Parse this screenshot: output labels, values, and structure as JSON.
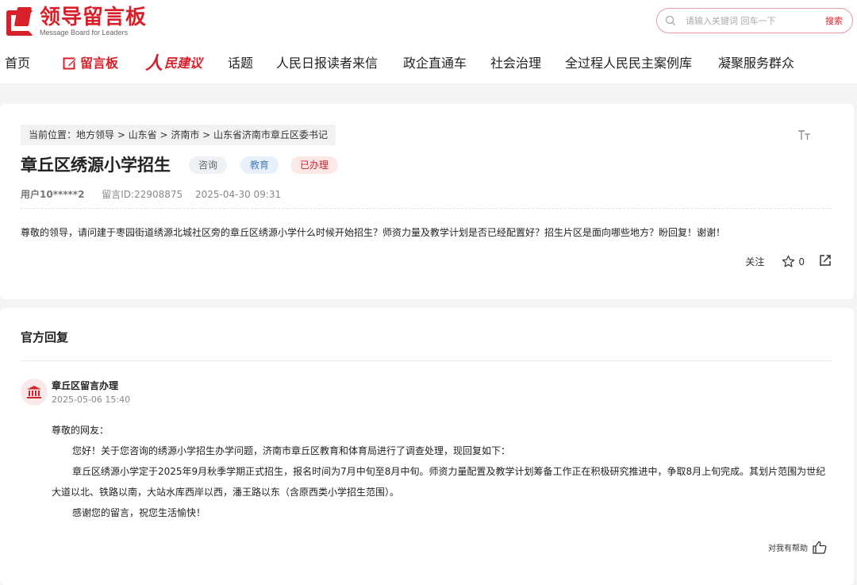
{
  "header": {
    "logo_cn": "领导留言板",
    "logo_en": "Message Board for Leaders",
    "search_placeholder": "请输入关键词 回车一下",
    "search_button": "搜索"
  },
  "nav": {
    "items": [
      "首页",
      "留言板",
      "人民建议",
      "话题",
      "人民日报读者来信",
      "政企直通车",
      "社会治理",
      "全过程人民民主案例库",
      "凝聚服务群众"
    ],
    "rmjy_ren": "人",
    "rmjy_rest": "民建议"
  },
  "post": {
    "breadcrumb": "当前位置：地方领导 > 山东省 > 济南市 > 山东省济南市章丘区委书记",
    "font_toggle": "TT",
    "title": "章丘区绣源小学招生",
    "tags": [
      "咨询",
      "教育",
      "已办理"
    ],
    "user": "用户10*****2",
    "message_id": "留言ID:22908875",
    "datetime": "2025-04-30 09:31",
    "content": "尊敬的领导，请问建于枣园街道绣源北城社区旁的章丘区绣源小学什么时候开始招生？师资力量及教学计划是否已经配置好？招生片区是面向哪些地方？盼回复！谢谢！",
    "follow_label": "关注",
    "star_count": "0"
  },
  "reply": {
    "heading": "官方回复",
    "department": "章丘区留言办理",
    "time": "2025-05-06 15:40",
    "greeting": "尊敬的网友：",
    "para1": "您好！关于您咨询的绣源小学招生办学问题，济南市章丘区教育和体育局进行了调查处理，现回复如下：",
    "para2": "章丘区绣源小学定于2025年9月秋季学期正式招生，报名时间为7月中旬至8月中旬。师资力量配置及教学计划筹备工作正在积极研究推进中，争取8月上旬完成。其划片范围为世纪大道以北、铁路以南，大站水库西岸以西，潘王路以东（含原西类小学招生范围）。",
    "para3": "感谢您的留言，祝您生活愉快！",
    "helpful_label": "对我有帮助"
  },
  "colors": {
    "brand_red": "#d7202a",
    "page_bg": "#f4f4f4"
  }
}
